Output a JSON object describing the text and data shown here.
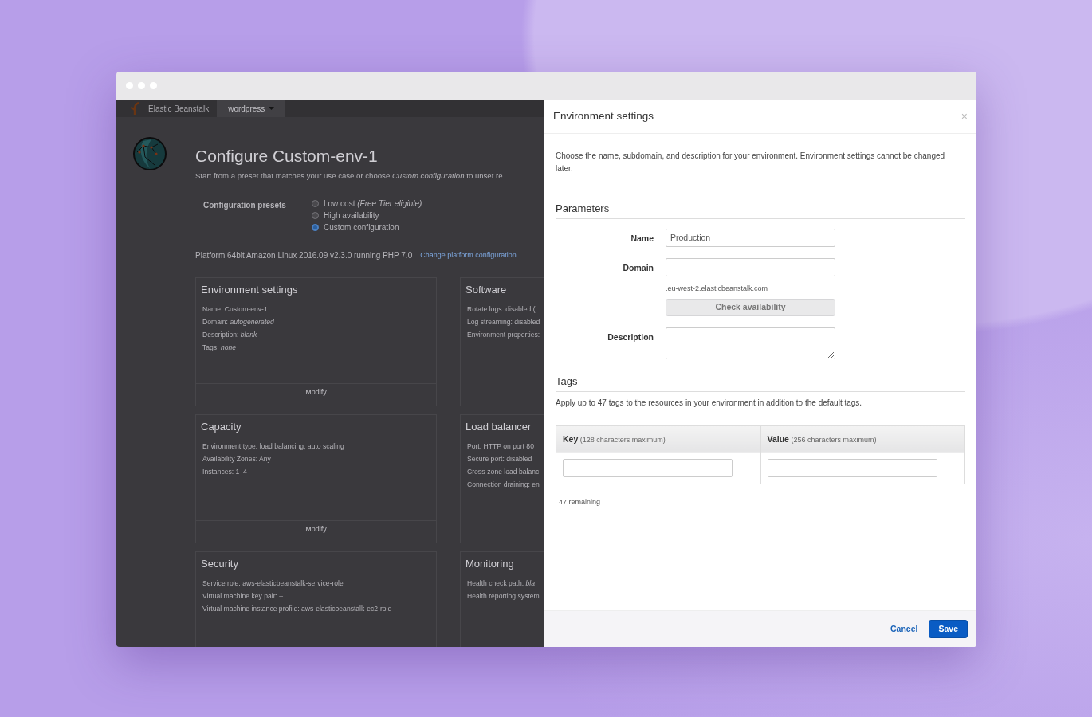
{
  "app_header": {
    "brand": "Elastic Beanstalk",
    "app_menu": "wordpress"
  },
  "page": {
    "title": "Configure Custom-env-1",
    "intro": "Start from a preset that matches your use case or choose *Custom configuration* to unset re",
    "presets_label": "Configuration presets",
    "presets": [
      {
        "label": "Low cost *(Free Tier eligible)*",
        "selected": false
      },
      {
        "label": "High availability",
        "selected": false
      },
      {
        "label": "Custom configuration",
        "selected": true
      }
    ],
    "platform": "Platform 64bit Amazon Linux 2016.09 v2.3.0 running PHP 7.0",
    "platform_link": "Change platform configuration"
  },
  "cards": [
    {
      "title": "Environment settings",
      "lines": [
        "Name: Custom-env-1",
        "Domain: *autogenerated*",
        "Description: *blank*",
        "Tags: *none*"
      ],
      "action": "Modify"
    },
    {
      "title": "Software",
      "lines": [
        "Rotate logs: disabled (",
        "Log streaming: disabled",
        "Environment properties:"
      ]
    },
    {
      "title": "Capacity",
      "lines": [
        "Environment type: load balancing, auto scaling",
        "Availability Zones: Any",
        "Instances: 1–4"
      ],
      "action": "Modify"
    },
    {
      "title": "Load balancer",
      "lines": [
        "Port: HTTP on port 80",
        "Secure port: disabled",
        "Cross-zone load balanc",
        "Connection draining: en"
      ]
    },
    {
      "title": "Security",
      "lines": [
        "Service role: aws-elasticbeanstalk-service-role",
        "Virtual machine key pair: *–*",
        "Virtual machine instance profile: aws-elasticbeanstalk-ec2-role"
      ]
    },
    {
      "title": "Monitoring",
      "lines": [
        "Health check path: *bla*",
        "Health reporting system"
      ]
    }
  ],
  "panel": {
    "title": "Environment settings",
    "close": "×",
    "intro": "Choose the name, subdomain, and description for your environment. Environment settings cannot be changed later.",
    "parameters_heading": "Parameters",
    "fields": [
      {
        "kind": "input",
        "label": "Name",
        "value": "Production"
      },
      {
        "kind": "input",
        "label": "Domain",
        "hint": ".eu-west-2.elasticbeanstalk.com",
        "button": "Check availability"
      },
      {
        "kind": "textarea",
        "label": "Description"
      }
    ],
    "tags_heading": "Tags",
    "tags_intro": "Apply up to 47 tags to the resources in your environment in addition to the default tags.",
    "tags_table": {
      "columns": [
        "**Key** (128 characters maximum)",
        "**Value** (256 characters maximum)"
      ],
      "rows": [
        [
          null,
          null
        ]
      ]
    },
    "remaining": "47 remaining",
    "footer": {
      "cancel": "Cancel",
      "save": "Save"
    }
  }
}
